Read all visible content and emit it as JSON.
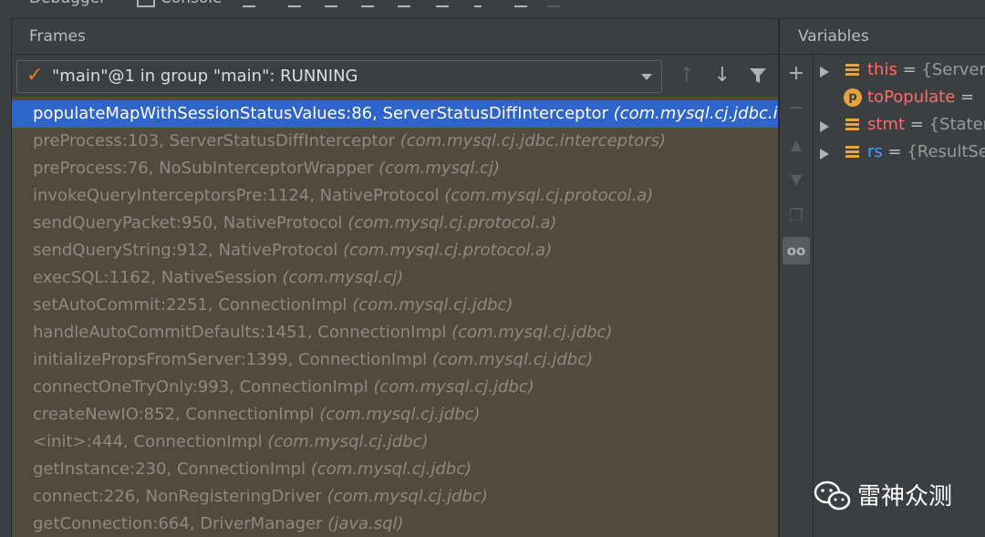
{
  "top_tabs": [
    {
      "label": "Debugger"
    },
    {
      "label": "Console"
    }
  ],
  "frames_panel": {
    "title": "Frames",
    "thread_selector": {
      "value": "\"main\"@1 in group \"main\": RUNNING"
    },
    "frames": [
      {
        "method": "populateMapWithSessionStatusValues:86, ServerStatusDiffInterceptor",
        "package": "(com.mysql.cj.jdbc.interceptors)"
      },
      {
        "method": "preProcess:103, ServerStatusDiffInterceptor",
        "package": "(com.mysql.cj.jdbc.interceptors)"
      },
      {
        "method": "preProcess:76, NoSubInterceptorWrapper",
        "package": "(com.mysql.cj)"
      },
      {
        "method": "invokeQueryInterceptorsPre:1124, NativeProtocol",
        "package": "(com.mysql.cj.protocol.a)"
      },
      {
        "method": "sendQueryPacket:950, NativeProtocol",
        "package": "(com.mysql.cj.protocol.a)"
      },
      {
        "method": "sendQueryString:912, NativeProtocol",
        "package": "(com.mysql.cj.protocol.a)"
      },
      {
        "method": "execSQL:1162, NativeSession",
        "package": "(com.mysql.cj)"
      },
      {
        "method": "setAutoCommit:2251, ConnectionImpl",
        "package": "(com.mysql.cj.jdbc)"
      },
      {
        "method": "handleAutoCommitDefaults:1451, ConnectionImpl",
        "package": "(com.mysql.cj.jdbc)"
      },
      {
        "method": "initializePropsFromServer:1399, ConnectionImpl",
        "package": "(com.mysql.cj.jdbc)"
      },
      {
        "method": "connectOneTryOnly:993, ConnectionImpl",
        "package": "(com.mysql.cj.jdbc)"
      },
      {
        "method": "createNewIO:852, ConnectionImpl",
        "package": "(com.mysql.cj.jdbc)"
      },
      {
        "method": "<init>:444, ConnectionImpl",
        "package": "(com.mysql.cj.jdbc)"
      },
      {
        "method": "getInstance:230, ConnectionImpl",
        "package": "(com.mysql.cj.jdbc)"
      },
      {
        "method": "connect:226, NonRegisteringDriver",
        "package": "(com.mysql.cj.jdbc)"
      },
      {
        "method": "getConnection:664, DriverManager",
        "package": "(java.sql)"
      }
    ]
  },
  "variables_panel": {
    "title": "Variables",
    "items": [
      {
        "name": "this",
        "value": "{ServerStatusDiffInterceptor",
        "icon": "field-icon",
        "name_color": "#ff6b68"
      },
      {
        "name": "toPopulate",
        "value": "",
        "icon": "parameter-icon",
        "name_color": "#ff6b68"
      },
      {
        "name": "stmt",
        "value": "{StatementImpl",
        "icon": "field-icon",
        "name_color": "#ff6b68"
      },
      {
        "name": "rs",
        "value": "{ResultSetImpl",
        "icon": "field-icon",
        "name_color": "#4a9eff"
      }
    ]
  },
  "watermark": {
    "text": "雷神众测"
  }
}
